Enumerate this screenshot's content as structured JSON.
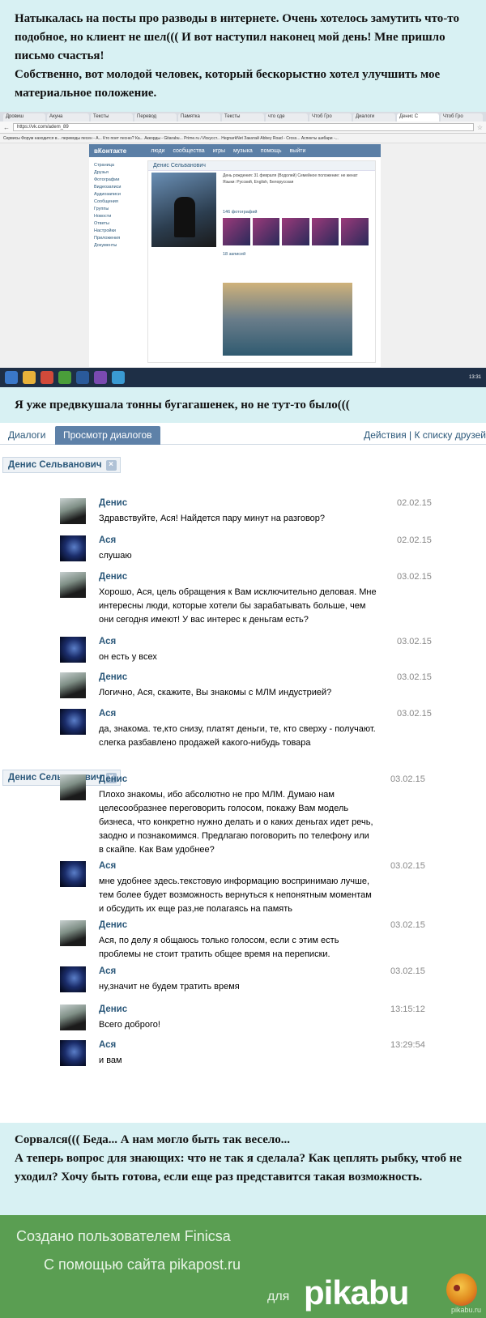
{
  "intro": {
    "p1": "Натыкалась на посты про разводы в интернете. Очень хотелось замутить что-то подобное, но клиент не шел((( И вот наступил наконец мой день! Мне пришло письмо счастья!",
    "p2": "Собственно, вот молодой человек, который бескорыстно хотел улучшить мое материальное положение."
  },
  "browser": {
    "tabs": [
      "Дровиш",
      "Акуна",
      "Тексты",
      "Перевод",
      "Памятка",
      "Тексты",
      "что сде",
      "Чтоб Гро",
      "Диалоги",
      "Денис С",
      "Чтоб Гро"
    ],
    "url": "https://vk.com/adem_89",
    "bookmarks": "Сервисы   Форум находится в...   переводы песен - А...   Кто поет песню? Ка...   Аккорды - Gitarabu...   Prime.ru / Искусст...   HegnarkNet   Закатай   Abbey Road - Cross...   Аспекты шибари -...",
    "vk": {
      "logo": "вКонтакте",
      "nav": [
        "люди",
        "сообщества",
        "игры",
        "музыка",
        "помощь",
        "выйти"
      ],
      "left_menu": [
        "Страница",
        "Друзья",
        "Фотографии",
        "Видеозаписи",
        "Аудиозаписи",
        "Сообщения",
        "Группы",
        "Новости",
        "Ответы",
        "Настройки",
        "Приложения",
        "Документы"
      ],
      "profile_name": "Денис Сельванович",
      "info": "День рождения: 31 февраля (Водолей)  Семейное положение: не женат  Языки: Русский, English, Белорусская",
      "photos_label": "146 фотографий",
      "posts_label": "18 записей"
    },
    "clock": "13:31"
  },
  "mid_caption": "Я уже предвкушала тонны бугагашенек, но не тут-то было(((",
  "dialog": {
    "tab_dialogs": "Диалоги",
    "tab_view": "Просмотр диалогов",
    "actions": "Действия  |  К списку друзей",
    "chip": "Денис Сельванович",
    "close": "×"
  },
  "messages1": [
    {
      "name": "Денис",
      "text": "Здравствуйте, Ася! Найдется пару минут на разговор?",
      "date": "02.02.15"
    },
    {
      "name": "Ася",
      "text": "слушаю",
      "date": "02.02.15"
    },
    {
      "name": "Денис",
      "text": "Хорошо, Ася, цель обращения к Вам исключительно деловая. Мне интересны люди, которые хотели бы зарабатывать больше, чем они сегодня имеют! У вас интерес к деньгам есть?",
      "date": "03.02.15"
    },
    {
      "name": "Ася",
      "text": "он есть у всех",
      "date": "03.02.15"
    },
    {
      "name": "Денис",
      "text": "Логично, Ася, скажите, Вы знакомы с МЛМ индустрией?",
      "date": "03.02.15"
    },
    {
      "name": "Ася",
      "text": "да, знакома. те,кто снизу, платят деньги, те, кто сверху - получают. слегка разбавлено продажей какого-нибудь товара",
      "date": "03.02.15"
    }
  ],
  "messages2": [
    {
      "name": "Денис",
      "text": "Плохо знакомы, ибо абсолютно не про МЛМ. Думаю нам целесообразнее переговорить голосом, покажу Вам модель бизнеса, что конкретно нужно делать и о каких деньгах идет речь, заодно и познакомимся. Предлагаю поговорить по телефону или в скайпе. Как Вам удобнее?",
      "date": "03.02.15"
    },
    {
      "name": "Ася",
      "text": "мне удобнее здесь.текстовую информацию воспринимаю лучше, тем более будет возможность вернуться к непонятным моментам и обсудить их еще раз,не полагаясь на память",
      "date": "03.02.15"
    },
    {
      "name": "Денис",
      "text": "Ася, по делу я общаюсь только голосом, если с этим есть проблемы не стоит тратить общее время на переписки.",
      "date": "03.02.15"
    },
    {
      "name": "Ася",
      "text": "ну,значит не будем тратить время",
      "date": "03.02.15"
    },
    {
      "name": "Денис",
      "text": "Всего доброго!",
      "date": "13:15:12"
    },
    {
      "name": "Ася",
      "text": "и вам",
      "date": "13:29:54"
    }
  ],
  "outro": {
    "p1": "Сорвался((( Беда... А нам могло быть так весело...",
    "p2": "А теперь вопрос для знающих: что не так я сделала? Как цеплять рыбку, чтоб не уходил? Хочу быть готова, если еще раз представится такая возможность."
  },
  "footer": {
    "created": "Создано пользователем Finicsa",
    "site": "С помощью сайта pikapost.ru",
    "for": "для",
    "brand": "pikabu",
    "watermark": "pikabu.ru"
  }
}
